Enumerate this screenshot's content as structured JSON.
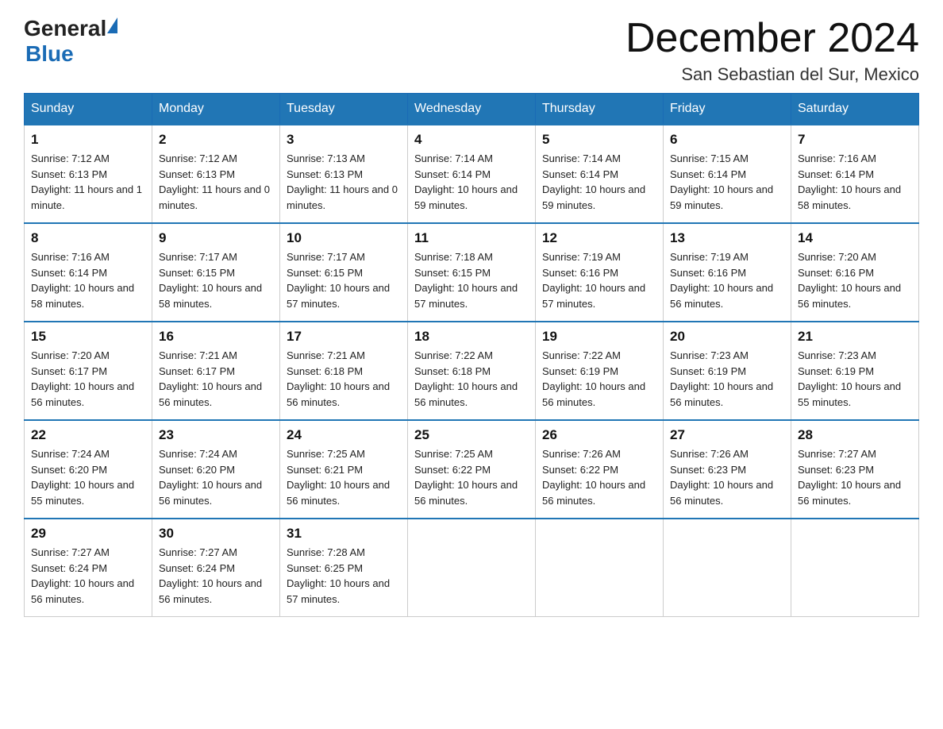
{
  "header": {
    "logo_general": "General",
    "logo_blue": "Blue",
    "month_title": "December 2024",
    "location": "San Sebastian del Sur, Mexico"
  },
  "columns": [
    "Sunday",
    "Monday",
    "Tuesday",
    "Wednesday",
    "Thursday",
    "Friday",
    "Saturday"
  ],
  "weeks": [
    [
      {
        "day": "1",
        "sunrise": "Sunrise: 7:12 AM",
        "sunset": "Sunset: 6:13 PM",
        "daylight": "Daylight: 11 hours and 1 minute."
      },
      {
        "day": "2",
        "sunrise": "Sunrise: 7:12 AM",
        "sunset": "Sunset: 6:13 PM",
        "daylight": "Daylight: 11 hours and 0 minutes."
      },
      {
        "day": "3",
        "sunrise": "Sunrise: 7:13 AM",
        "sunset": "Sunset: 6:13 PM",
        "daylight": "Daylight: 11 hours and 0 minutes."
      },
      {
        "day": "4",
        "sunrise": "Sunrise: 7:14 AM",
        "sunset": "Sunset: 6:14 PM",
        "daylight": "Daylight: 10 hours and 59 minutes."
      },
      {
        "day": "5",
        "sunrise": "Sunrise: 7:14 AM",
        "sunset": "Sunset: 6:14 PM",
        "daylight": "Daylight: 10 hours and 59 minutes."
      },
      {
        "day": "6",
        "sunrise": "Sunrise: 7:15 AM",
        "sunset": "Sunset: 6:14 PM",
        "daylight": "Daylight: 10 hours and 59 minutes."
      },
      {
        "day": "7",
        "sunrise": "Sunrise: 7:16 AM",
        "sunset": "Sunset: 6:14 PM",
        "daylight": "Daylight: 10 hours and 58 minutes."
      }
    ],
    [
      {
        "day": "8",
        "sunrise": "Sunrise: 7:16 AM",
        "sunset": "Sunset: 6:14 PM",
        "daylight": "Daylight: 10 hours and 58 minutes."
      },
      {
        "day": "9",
        "sunrise": "Sunrise: 7:17 AM",
        "sunset": "Sunset: 6:15 PM",
        "daylight": "Daylight: 10 hours and 58 minutes."
      },
      {
        "day": "10",
        "sunrise": "Sunrise: 7:17 AM",
        "sunset": "Sunset: 6:15 PM",
        "daylight": "Daylight: 10 hours and 57 minutes."
      },
      {
        "day": "11",
        "sunrise": "Sunrise: 7:18 AM",
        "sunset": "Sunset: 6:15 PM",
        "daylight": "Daylight: 10 hours and 57 minutes."
      },
      {
        "day": "12",
        "sunrise": "Sunrise: 7:19 AM",
        "sunset": "Sunset: 6:16 PM",
        "daylight": "Daylight: 10 hours and 57 minutes."
      },
      {
        "day": "13",
        "sunrise": "Sunrise: 7:19 AM",
        "sunset": "Sunset: 6:16 PM",
        "daylight": "Daylight: 10 hours and 56 minutes."
      },
      {
        "day": "14",
        "sunrise": "Sunrise: 7:20 AM",
        "sunset": "Sunset: 6:16 PM",
        "daylight": "Daylight: 10 hours and 56 minutes."
      }
    ],
    [
      {
        "day": "15",
        "sunrise": "Sunrise: 7:20 AM",
        "sunset": "Sunset: 6:17 PM",
        "daylight": "Daylight: 10 hours and 56 minutes."
      },
      {
        "day": "16",
        "sunrise": "Sunrise: 7:21 AM",
        "sunset": "Sunset: 6:17 PM",
        "daylight": "Daylight: 10 hours and 56 minutes."
      },
      {
        "day": "17",
        "sunrise": "Sunrise: 7:21 AM",
        "sunset": "Sunset: 6:18 PM",
        "daylight": "Daylight: 10 hours and 56 minutes."
      },
      {
        "day": "18",
        "sunrise": "Sunrise: 7:22 AM",
        "sunset": "Sunset: 6:18 PM",
        "daylight": "Daylight: 10 hours and 56 minutes."
      },
      {
        "day": "19",
        "sunrise": "Sunrise: 7:22 AM",
        "sunset": "Sunset: 6:19 PM",
        "daylight": "Daylight: 10 hours and 56 minutes."
      },
      {
        "day": "20",
        "sunrise": "Sunrise: 7:23 AM",
        "sunset": "Sunset: 6:19 PM",
        "daylight": "Daylight: 10 hours and 56 minutes."
      },
      {
        "day": "21",
        "sunrise": "Sunrise: 7:23 AM",
        "sunset": "Sunset: 6:19 PM",
        "daylight": "Daylight: 10 hours and 55 minutes."
      }
    ],
    [
      {
        "day": "22",
        "sunrise": "Sunrise: 7:24 AM",
        "sunset": "Sunset: 6:20 PM",
        "daylight": "Daylight: 10 hours and 55 minutes."
      },
      {
        "day": "23",
        "sunrise": "Sunrise: 7:24 AM",
        "sunset": "Sunset: 6:20 PM",
        "daylight": "Daylight: 10 hours and 56 minutes."
      },
      {
        "day": "24",
        "sunrise": "Sunrise: 7:25 AM",
        "sunset": "Sunset: 6:21 PM",
        "daylight": "Daylight: 10 hours and 56 minutes."
      },
      {
        "day": "25",
        "sunrise": "Sunrise: 7:25 AM",
        "sunset": "Sunset: 6:22 PM",
        "daylight": "Daylight: 10 hours and 56 minutes."
      },
      {
        "day": "26",
        "sunrise": "Sunrise: 7:26 AM",
        "sunset": "Sunset: 6:22 PM",
        "daylight": "Daylight: 10 hours and 56 minutes."
      },
      {
        "day": "27",
        "sunrise": "Sunrise: 7:26 AM",
        "sunset": "Sunset: 6:23 PM",
        "daylight": "Daylight: 10 hours and 56 minutes."
      },
      {
        "day": "28",
        "sunrise": "Sunrise: 7:27 AM",
        "sunset": "Sunset: 6:23 PM",
        "daylight": "Daylight: 10 hours and 56 minutes."
      }
    ],
    [
      {
        "day": "29",
        "sunrise": "Sunrise: 7:27 AM",
        "sunset": "Sunset: 6:24 PM",
        "daylight": "Daylight: 10 hours and 56 minutes."
      },
      {
        "day": "30",
        "sunrise": "Sunrise: 7:27 AM",
        "sunset": "Sunset: 6:24 PM",
        "daylight": "Daylight: 10 hours and 56 minutes."
      },
      {
        "day": "31",
        "sunrise": "Sunrise: 7:28 AM",
        "sunset": "Sunset: 6:25 PM",
        "daylight": "Daylight: 10 hours and 57 minutes."
      },
      null,
      null,
      null,
      null
    ]
  ]
}
